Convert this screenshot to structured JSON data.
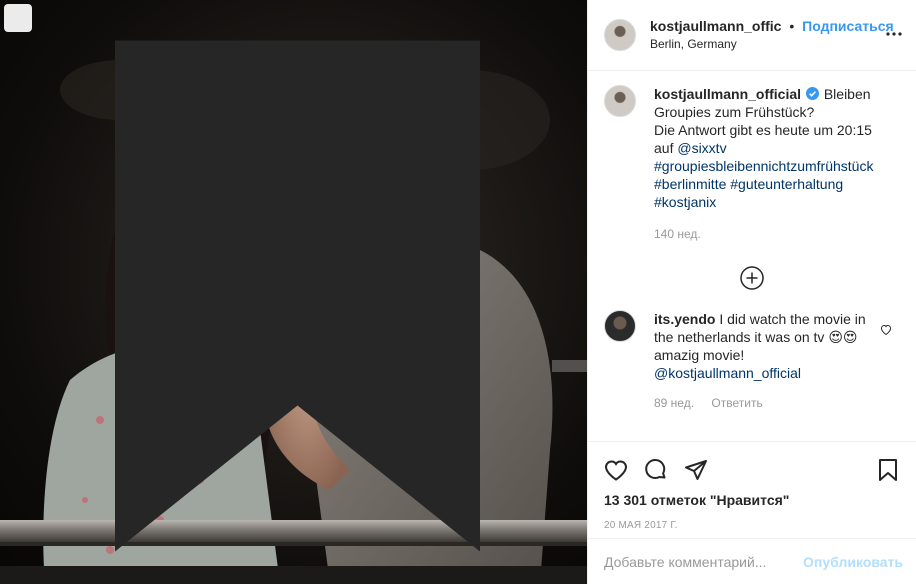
{
  "post": {
    "author": "kostjaullmann_offic",
    "separator": "•",
    "follow_label": "Подписаться",
    "location": "Berlin, Germany"
  },
  "caption": {
    "author": "kostjaullmann_official",
    "text_line1": "Bleiben",
    "text_line2": "Groupies zum Frühstück?",
    "text_line3": "Die Antwort gibt es heute um 20:15",
    "text_line4_prefix": "auf ",
    "mention": "@sixxtv",
    "tags": [
      "#groupiesbleibennichtzumfrühstück",
      "#berlinmitte",
      "#guteunterhaltung",
      "#kostjanix"
    ],
    "age": "140 нед."
  },
  "comment": {
    "author": "its.yendo",
    "text": "I did watch the movie in the netherlands it was on tv 😍😍 amazig movie!",
    "mention": "@kostjaullmann_official",
    "age": "89 нед.",
    "reply_label": "Ответить"
  },
  "stats": {
    "likes": "13 301 отметок \"Нравится\"",
    "date": "20 МАЯ 2017 Г."
  },
  "composer": {
    "placeholder": "Добавьте комментарий...",
    "publish_label": "Опубликовать"
  },
  "icons": {
    "save_badge": "bookmark-icon",
    "more": "more-dots-icon",
    "verified": "verified-badge-icon",
    "load_more": "plus-circle-icon",
    "comment_like": "heart-small-icon",
    "like": "heart-icon",
    "comment": "comment-icon",
    "share": "share-icon",
    "save": "bookmark-icon"
  },
  "colors": {
    "link": "#3897f0",
    "hashtag": "#003569",
    "muted": "#999999",
    "publish_disabled": "#b2dffc",
    "verified": "#3897f0"
  }
}
